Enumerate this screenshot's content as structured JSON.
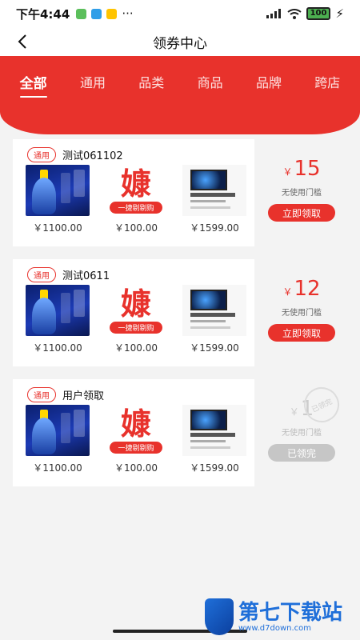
{
  "status_bar": {
    "time": "下午4:44",
    "battery": "100"
  },
  "nav": {
    "title": "领券中心"
  },
  "tabs": [
    {
      "label": "全部",
      "active": true
    },
    {
      "label": "通用",
      "active": false
    },
    {
      "label": "品类",
      "active": false
    },
    {
      "label": "商品",
      "active": false
    },
    {
      "label": "品牌",
      "active": false
    },
    {
      "label": "跨店",
      "active": false
    }
  ],
  "coupons": [
    {
      "tag": "通用",
      "title": "测试061102",
      "products": [
        {
          "image": "baijiu-bottle",
          "price": "￥1100.00"
        },
        {
          "image": "red-logo",
          "logo_char": "嫝",
          "ribbon": "一捷剔剔购",
          "price": "￥100.00"
        },
        {
          "image": "macbook-air",
          "price": "￥1599.00"
        }
      ],
      "yen": "￥",
      "amount": "15",
      "threshold": "无使用门槛",
      "button": "立即领取",
      "status": "available"
    },
    {
      "tag": "通用",
      "title": "测试0611",
      "products": [
        {
          "image": "baijiu-bottle",
          "price": "￥1100.00"
        },
        {
          "image": "red-logo",
          "logo_char": "嫝",
          "ribbon": "一捷剔剔购",
          "price": "￥100.00"
        },
        {
          "image": "macbook-air",
          "price": "￥1599.00"
        }
      ],
      "yen": "￥",
      "amount": "12",
      "threshold": "无使用门槛",
      "button": "立即领取",
      "status": "available"
    },
    {
      "tag": "通用",
      "title": "用户领取",
      "products": [
        {
          "image": "baijiu-bottle",
          "price": "￥1100.00"
        },
        {
          "image": "red-logo",
          "logo_char": "嫝",
          "ribbon": "一捷剔剔购",
          "price": "￥100.00"
        },
        {
          "image": "macbook-air",
          "price": "￥1599.00"
        }
      ],
      "yen": "￥",
      "amount": "1",
      "threshold": "无使用门槛",
      "button": "已领完",
      "stamp": "已领完",
      "status": "sold-out"
    }
  ],
  "watermark": {
    "title": "第七下载站",
    "url": "www.d7down.com"
  },
  "colors": {
    "accent": "#e8322c",
    "disabled": "#c6c6c6"
  }
}
